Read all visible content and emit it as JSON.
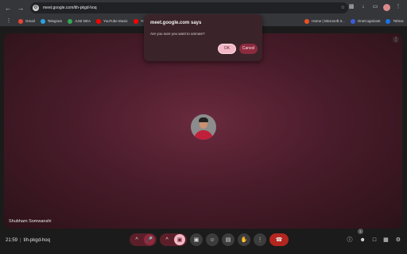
{
  "browser": {
    "url": "meet.google.com/tih-pkgd-hoq",
    "bookmarks": [
      {
        "label": "Gmail",
        "color": "#ea4335"
      },
      {
        "label": "Telegram",
        "color": "#2aa3df"
      },
      {
        "label": "AJIZ DEA",
        "color": "#34a853"
      },
      {
        "label": "YouTube Music",
        "color": "#ff0000"
      },
      {
        "label": "YouTube",
        "color": "#ff0000"
      },
      {
        "label": "Ch",
        "color": "#bbbbbb"
      }
    ],
    "bookmarks_right": [
      {
        "label": "Home | Microsoft 3...",
        "color": "#f25022"
      },
      {
        "label": "OneCognizant",
        "color": "#3b5bdb"
      },
      {
        "label": "TelSac",
        "color": "#1a73e8"
      }
    ]
  },
  "dialog": {
    "title": "meet.google.com says",
    "message": "Are you sure you want to unmute?",
    "ok_label": "OK",
    "cancel_label": "Cancel"
  },
  "meeting": {
    "participant_name": "Shubham Somwanshi",
    "time": "21:59",
    "code": "tih-pkgd-hoq",
    "participant_count": "1"
  },
  "colors": {
    "accent_pink": "#f2b8c6",
    "end_call_red": "#b3261e"
  }
}
